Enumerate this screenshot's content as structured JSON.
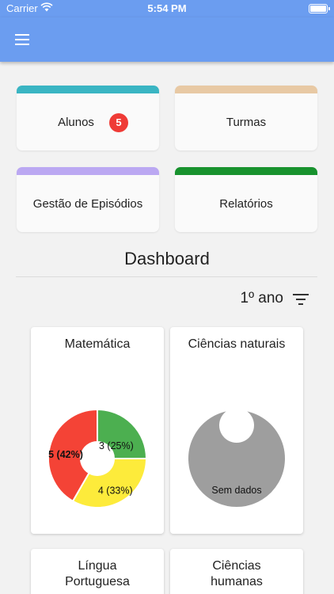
{
  "status_bar": {
    "carrier": "Carrier",
    "time": "5:54 PM"
  },
  "app_bar": {
    "menu_icon": "hamburger-icon"
  },
  "tiles": [
    {
      "label": "Alunos",
      "color": "#3ab5c3",
      "badge": "5"
    },
    {
      "label": "Turmas",
      "color": "#e8c9a4"
    },
    {
      "label": "Gestão de Episódios",
      "color": "#bba8f2"
    },
    {
      "label": "Relatórios",
      "color": "#18922e"
    }
  ],
  "dashboard": {
    "title": "Dashboard",
    "year": "1º ano",
    "filter_icon": "filter-icon"
  },
  "cards": [
    {
      "title": "Matemática"
    },
    {
      "title": "Ciências naturais"
    },
    {
      "title": "Língua Portuguesa"
    },
    {
      "title": "Ciências humanas"
    }
  ],
  "chart_data": [
    {
      "type": "pie",
      "title": "Matemática",
      "donut": true,
      "slices": [
        {
          "value": 3,
          "label": "3 (25%)",
          "color": "#4caf50"
        },
        {
          "value": 4,
          "label": "4 (33%)",
          "color": "#fdeb3b"
        },
        {
          "value": 5,
          "label": "5 (42%)",
          "color": "#f44336"
        }
      ]
    },
    {
      "type": "pie",
      "title": "Ciências naturais",
      "donut": true,
      "slices": [
        {
          "value": 1,
          "label": "Sem dados",
          "color": "#9e9e9e"
        }
      ]
    }
  ]
}
